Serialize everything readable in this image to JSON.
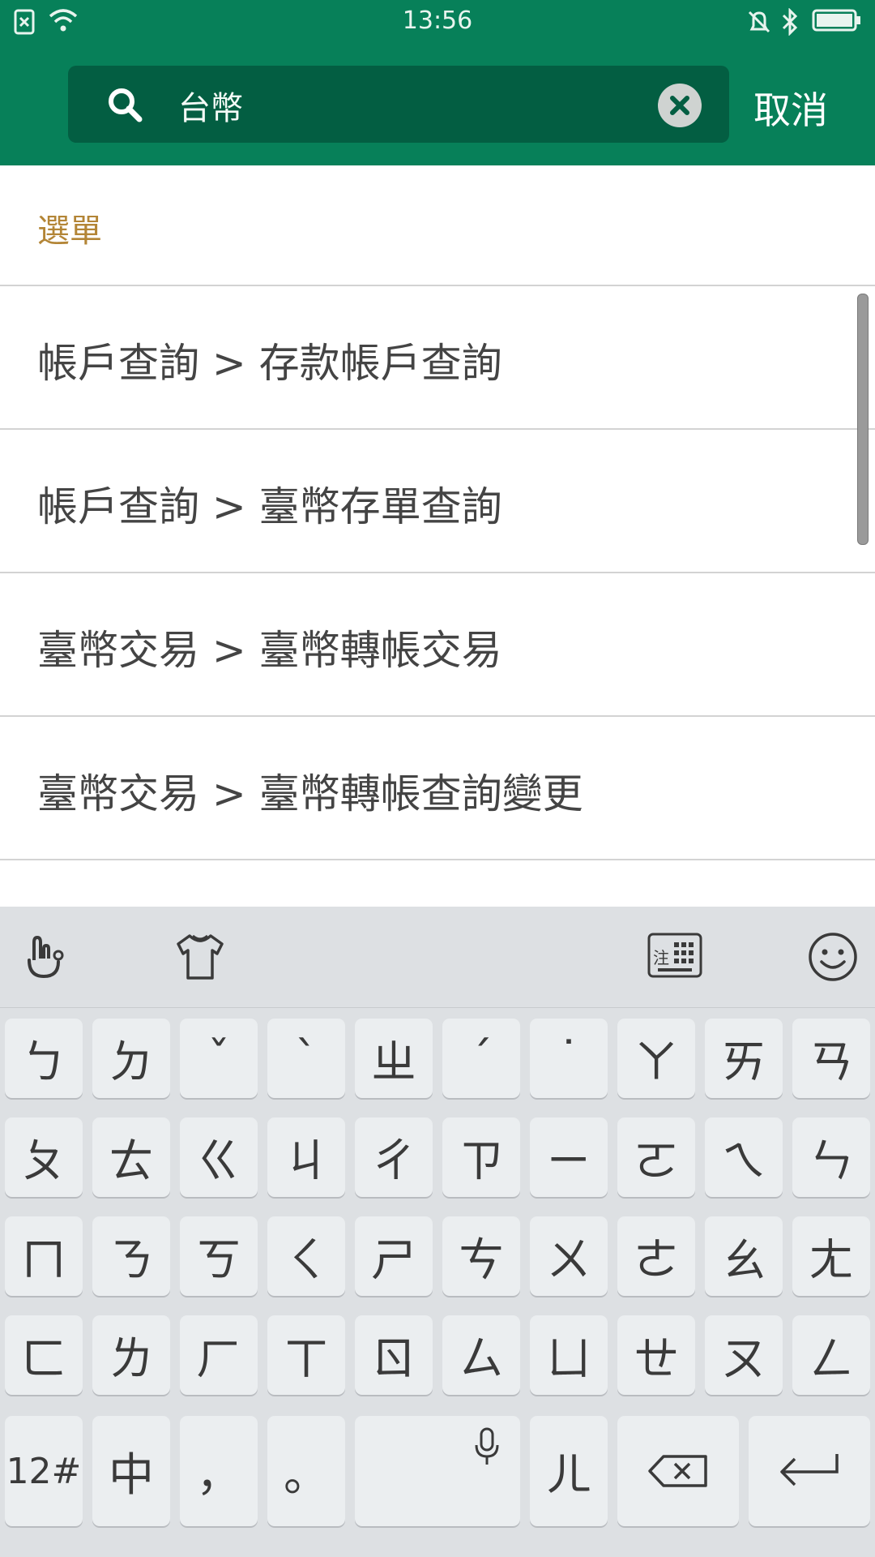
{
  "status_bar": {
    "time": "13:56",
    "icons": [
      "sim-off-icon",
      "wifi-icon",
      "bell-off-icon",
      "bluetooth-icon",
      "battery-icon"
    ]
  },
  "search": {
    "query": "台幣",
    "cancel_label": "取消"
  },
  "results": {
    "section_label": "選單",
    "items": [
      "帳戶查詢 > 存款帳戶查詢",
      "帳戶查詢 > 臺幣存單查詢",
      "臺幣交易 > 臺幣轉帳交易",
      "臺幣交易 > 臺幣轉帳查詢變更"
    ]
  },
  "keyboard": {
    "toolbar_icons": [
      "handwriting-icon",
      "theme-shirt-icon",
      "zhuyin-keyboard-icon",
      "emoji-icon"
    ],
    "rows": [
      [
        "ㄅ",
        "ㄉ",
        "ˇ",
        "ˋ",
        "ㄓ",
        "ˊ",
        "˙",
        "ㄚ",
        "ㄞ",
        "ㄢ"
      ],
      [
        "ㄆ",
        "ㄊ",
        "ㄍ",
        "ㄐ",
        "ㄔ",
        "ㄗ",
        "ㄧ",
        "ㄛ",
        "ㄟ",
        "ㄣ"
      ],
      [
        "ㄇ",
        "ㄋ",
        "ㄎ",
        "ㄑ",
        "ㄕ",
        "ㄘ",
        "ㄨ",
        "ㄜ",
        "ㄠ",
        "ㄤ"
      ],
      [
        "ㄈ",
        "ㄌ",
        "ㄏ",
        "ㄒ",
        "ㄖ",
        "ㄙ",
        "ㄩ",
        "ㄝ",
        "ㄡ",
        "ㄥ"
      ]
    ],
    "bottom": {
      "numbers": "12#",
      "language": "中",
      "comma": "，",
      "period": "。",
      "er": "ㄦ"
    }
  }
}
